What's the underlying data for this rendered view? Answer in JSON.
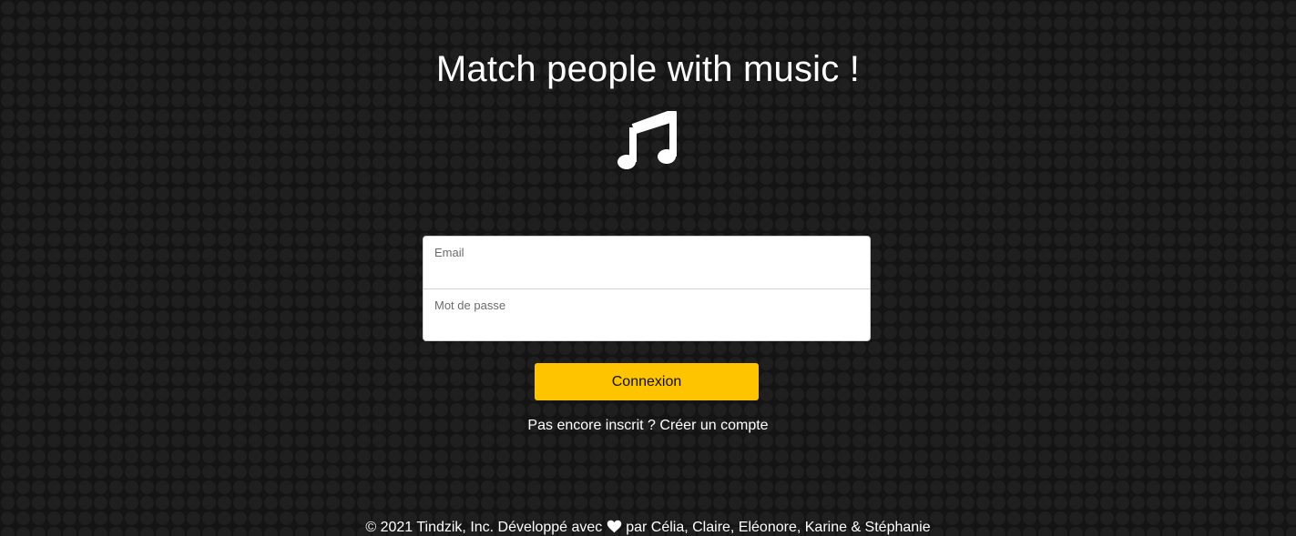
{
  "header": {
    "title": "Match people with music !",
    "logo_icon": "music-note-icon"
  },
  "form": {
    "email_label": "Email",
    "email_value": "",
    "password_label": "Mot de passe",
    "password_value": ""
  },
  "actions": {
    "login_label": "Connexion",
    "signup_prompt": "Pas encore inscrit ?",
    "signup_link": "Créer un compte"
  },
  "footer": {
    "prefix": "© 2021 Tindzik, Inc. Développé avec",
    "heart_icon": "heart-icon",
    "suffix": "par Célia, Claire, Eléonore, Karine & Stéphanie"
  },
  "colors": {
    "background": "#141414",
    "accent": "#ffc400",
    "text": "#ffffff"
  }
}
